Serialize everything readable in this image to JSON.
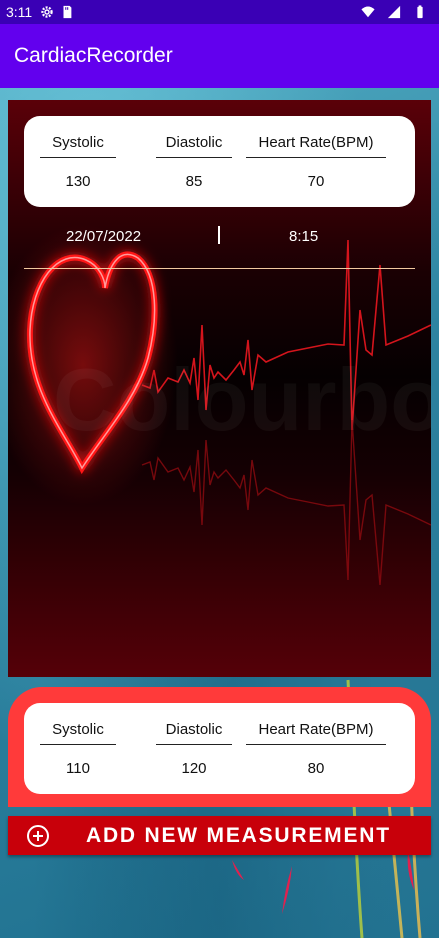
{
  "status_bar": {
    "time": "3:11",
    "icons": [
      "gear-icon",
      "sd-card-icon",
      "wifi-icon",
      "signal-icon",
      "battery-icon"
    ]
  },
  "app_bar": {
    "title": "CardiacRecorder"
  },
  "latest": {
    "systolic_label": "Systolic",
    "diastolic_label": "Diastolic",
    "heart_rate_label": "Heart Rate(BPM)",
    "systolic": "130",
    "diastolic": "85",
    "heart_rate": "70",
    "date": "22/07/2022",
    "time": "8:15",
    "watermark": "Colourbox"
  },
  "record": {
    "systolic_label": "Systolic",
    "diastolic_label": "Diastolic",
    "heart_rate_label": "Heart Rate(BPM)",
    "systolic": "110",
    "diastolic": "120",
    "heart_rate": "80"
  },
  "add_button": {
    "label": "ADD NEW MEASUREMENT",
    "icon": "add-circle-icon"
  },
  "colors": {
    "status_bar": "#3a00b5",
    "app_bar": "#6200ee",
    "record_card": "#ff3a3a",
    "add_button": "#c8000a"
  }
}
